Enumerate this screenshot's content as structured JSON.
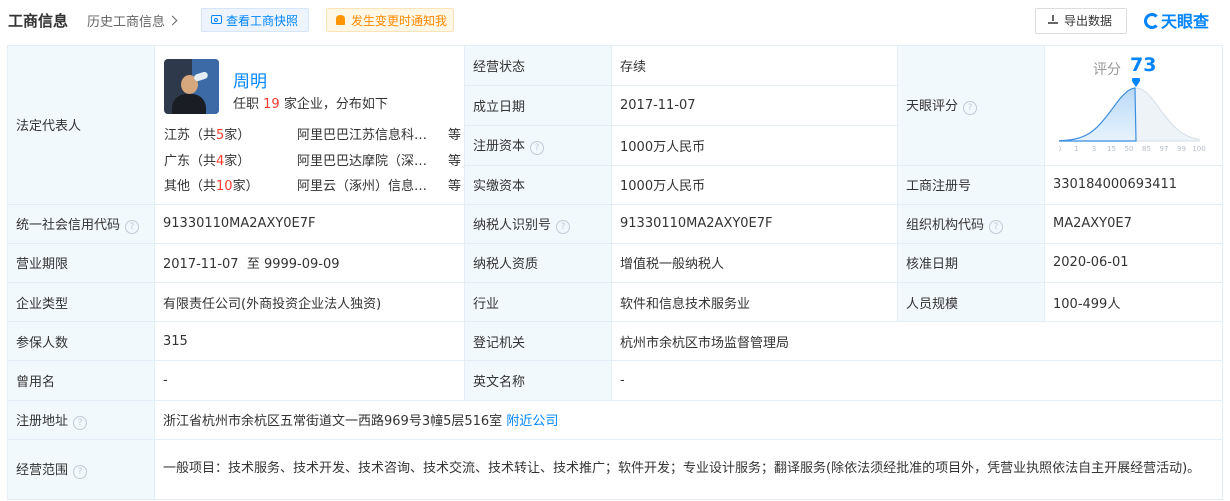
{
  "header": {
    "title": "工商信息",
    "history": "历史工商信息",
    "snapshot_button": "查看工商快照",
    "notify_button": "发生变更时通知我",
    "export_button": "导出数据",
    "logo_text": "天眼查"
  },
  "legal_rep": {
    "label": "法定代表人",
    "name": "周明",
    "tenure_prefix": "任职",
    "tenure_count": "19",
    "tenure_suffix": "家企业，分布如下",
    "regions": [
      {
        "region_prefix": "江苏（共",
        "count": "5",
        "region_suffix": "家）",
        "company": "阿里巴巴江苏信息科技有限公司",
        "more": "等"
      },
      {
        "region_prefix": "广东（共",
        "count": "4",
        "region_suffix": "家）",
        "company": "阿里巴巴达摩院（深圳）科技有限公司",
        "more": "等"
      },
      {
        "region_prefix": "其他（共",
        "count": "10",
        "region_suffix": "家）",
        "company": "阿里云（涿州）信息技术有限公司",
        "more": "等"
      }
    ]
  },
  "fields": {
    "status_label": "经营状态",
    "status": "存续",
    "founded_label": "成立日期",
    "founded": "2017-11-07",
    "capital_label": "注册资本",
    "capital": "1000万人民币",
    "paid_label": "实缴资本",
    "paid": "1000万人民币",
    "tyscore_label": "天眼评分",
    "reg_no_label": "工商注册号",
    "reg_no": "330184000693411",
    "credit_label": "统一社会信用代码",
    "credit": "91330110MA2AXY0E7F",
    "taxid_label": "纳税人识别号",
    "taxid": "91330110MA2AXY0E7F",
    "org_label": "组织机构代码",
    "org": "MA2AXY0E7",
    "term_label": "营业期限",
    "term": "2017-11-07  至 9999-09-09",
    "tax_qual_label": "纳税人资质",
    "tax_qual": "增值税一般纳税人",
    "approve_label": "核准日期",
    "approve": "2020-06-01",
    "type_label": "企业类型",
    "type": "有限责任公司(外商投资企业法人独资)",
    "industry_label": "行业",
    "industry": "软件和信息技术服务业",
    "staff_label": "人员规模",
    "staff": "100-499人",
    "insured_label": "参保人数",
    "insured": "315",
    "authority_label": "登记机关",
    "authority": "杭州市余杭区市场监督管理局",
    "former_label": "曾用名",
    "former": "-",
    "en_label": "英文名称",
    "en": "-",
    "address_label": "注册地址",
    "address": "浙江省杭州市余杭区五常街道文一西路969号3幢5层516室",
    "nearby": "附近公司",
    "scope_label": "经营范围",
    "scope": "一般项目：技术服务、技术开发、技术咨询、技术交流、技术转让、技术推广；软件开发；专业设计服务；翻译服务(除依法须经批准的项目外，凭营业执照依法自主开展经营活动)。"
  },
  "score": {
    "label": "评分",
    "value": 73,
    "ticks": [
      "0",
      "1",
      "3",
      "15",
      "50",
      "85",
      "97",
      "99",
      "100"
    ]
  },
  "colors": {
    "accent": "#0084ff",
    "highlight": "#ff3b30",
    "label_bg": "#f2f9fc",
    "border": "#e4eef6"
  }
}
